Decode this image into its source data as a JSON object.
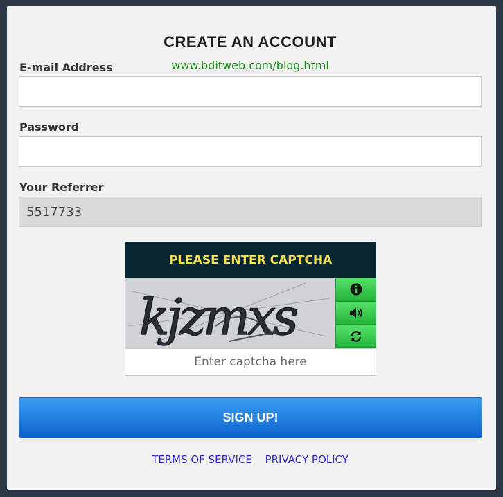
{
  "form": {
    "title": "CREATE AN ACCOUNT",
    "watermark": "www.bditweb.com/blog.html",
    "email_label": "E-mail Address",
    "email_value": "",
    "password_label": "Password",
    "password_value": "",
    "referrer_label": "Your Referrer",
    "referrer_value": "5517733"
  },
  "captcha": {
    "heading": "PLEASE ENTER CAPTCHA",
    "image_text": "kjzmxs",
    "input_placeholder": "Enter captcha here",
    "buttons": [
      "info-icon",
      "speaker-icon",
      "refresh-icon"
    ]
  },
  "signup_label": "SIGN UP!",
  "links": {
    "terms": "TERMS OF SERVICE",
    "privacy": "PRIVACY POLICY"
  },
  "colors": {
    "page_bg": "#2c3a47",
    "card_bg": "#f2f2f2",
    "watermark": "#1a8a1a",
    "captcha_head_bg": "#062630",
    "captcha_head_text": "#f4e050",
    "captcha_button": "#2ec847",
    "signup_button": "#1e7fe0",
    "link": "#2a2ad0"
  }
}
